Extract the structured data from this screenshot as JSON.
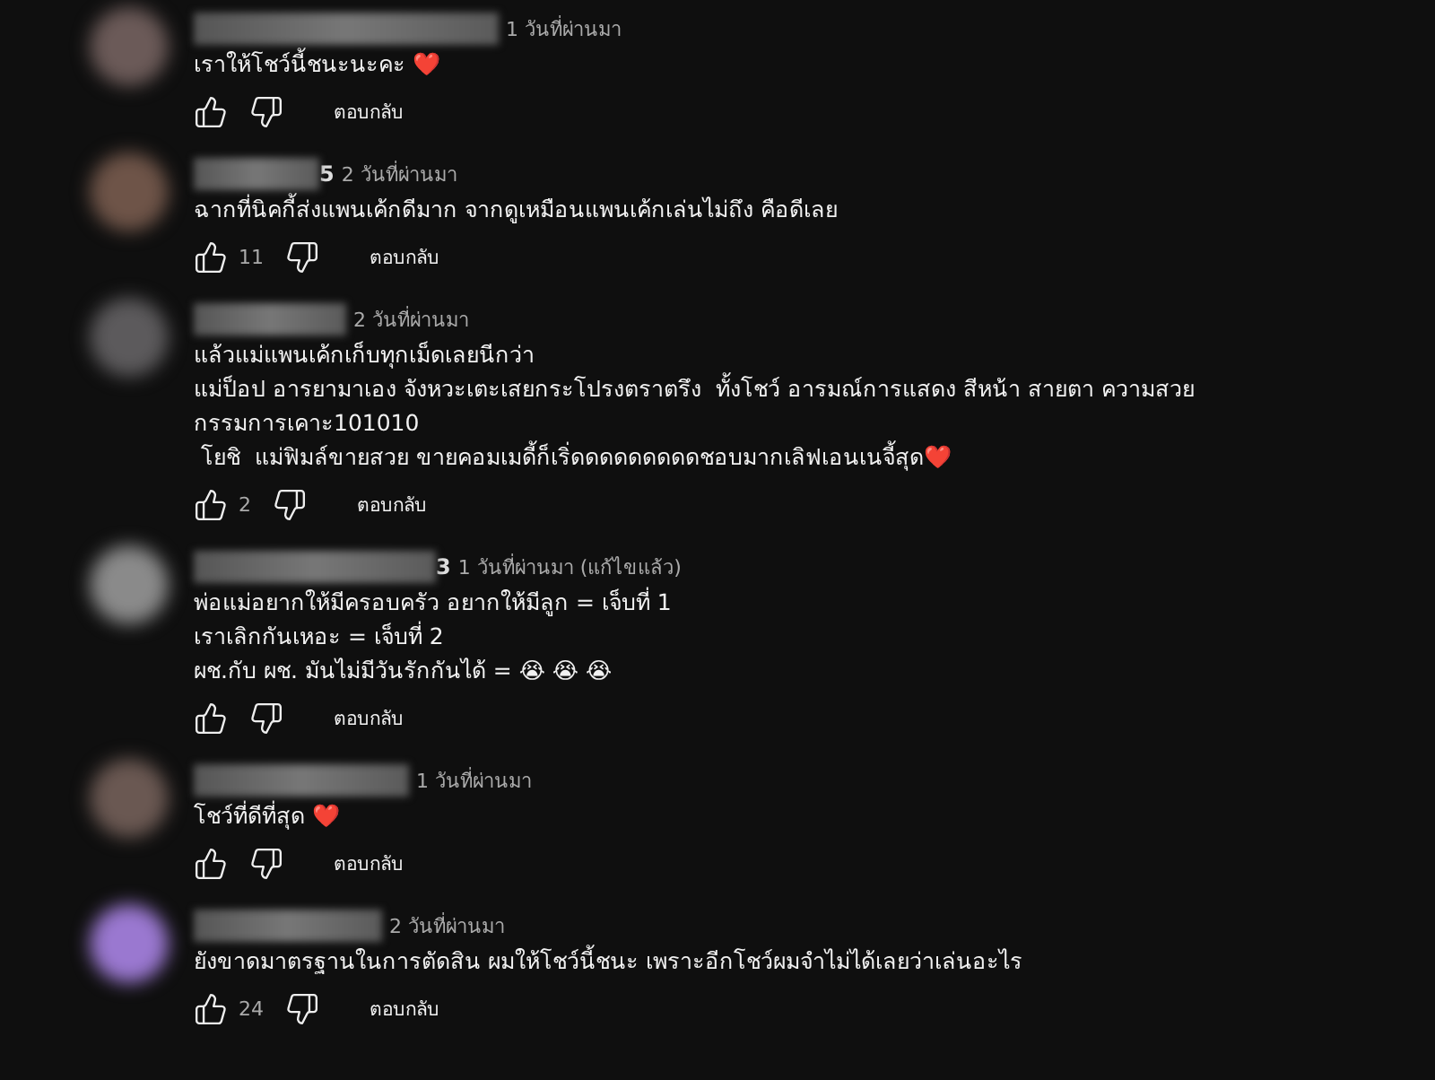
{
  "comments": [
    {
      "color": "#6b5a58",
      "time": "1 วันที่ผ่านมา",
      "text": [
        "เราให้โชว์นี้ชนะนะคะ ❤️"
      ],
      "reply": "ตอบกลับ"
    },
    {
      "color": "#6e5448",
      "name_tail": "5",
      "time": "2 วันที่ผ่านมา",
      "text": [
        "ฉากที่นิคกี้ส่งแพนเค้กดีมาก จากดูเหมือนแพนเค้กเล่นไม่ถึง คือดีเลย"
      ],
      "likes": "11",
      "reply": "ตอบกลับ"
    },
    {
      "color": "#5c5a5c",
      "time": "2 วันที่ผ่านมา",
      "text": [
        "แล้วแม่แพนเค้กเก็บทุกเม็ดเลยนีกว่า",
        "แม่ป็อป อารยามาเอง จังหวะเตะเสยกระโปรงตราตรึง  ทั้งโชว์ อารมณ์การแสดง สีหน้า สายตา ความสวย",
        "กรรมการเคาะ101010",
        " โยชิ  แม่ฟิมล์ขายสวย ขายคอมเมดี้ก็เริ่ดดดดดดดดดชอบมากเลิฟเอนเนจี้สุด❤️"
      ],
      "likes": "2",
      "reply": "ตอบกลับ"
    },
    {
      "color": "#8a8a8a",
      "name_tail": "3",
      "time": "1 วันที่ผ่านมา (แก้ไขแล้ว)",
      "text": [
        "พ่อแม่อยากให้มีครอบครัว อยากให้มีลูก = เจ็บที่ 1",
        "เราเลิกกันเหอะ = เจ็บที่ 2",
        "ผช.กับ ผช. มันไม่มีวันรักกันได้ = 😭 😭 😭"
      ],
      "reply": "ตอบกลับ"
    },
    {
      "color": "#6a5852",
      "time": "1 วันที่ผ่านมา",
      "text": [
        "โชว์ที่ดีที่สุด ❤️"
      ],
      "reply": "ตอบกลับ"
    },
    {
      "color": "#9a78d0",
      "time": "2 วันที่ผ่านมา",
      "text": [
        "ยังขาดมาตรฐานในการตัดสิน ผมให้โชว์นี้ชนะ เพราะอีกโชว์ผมจำไม่ได้เลยว่าเล่นอะไร"
      ],
      "likes": "24",
      "reply": "ตอบกลับ"
    }
  ]
}
